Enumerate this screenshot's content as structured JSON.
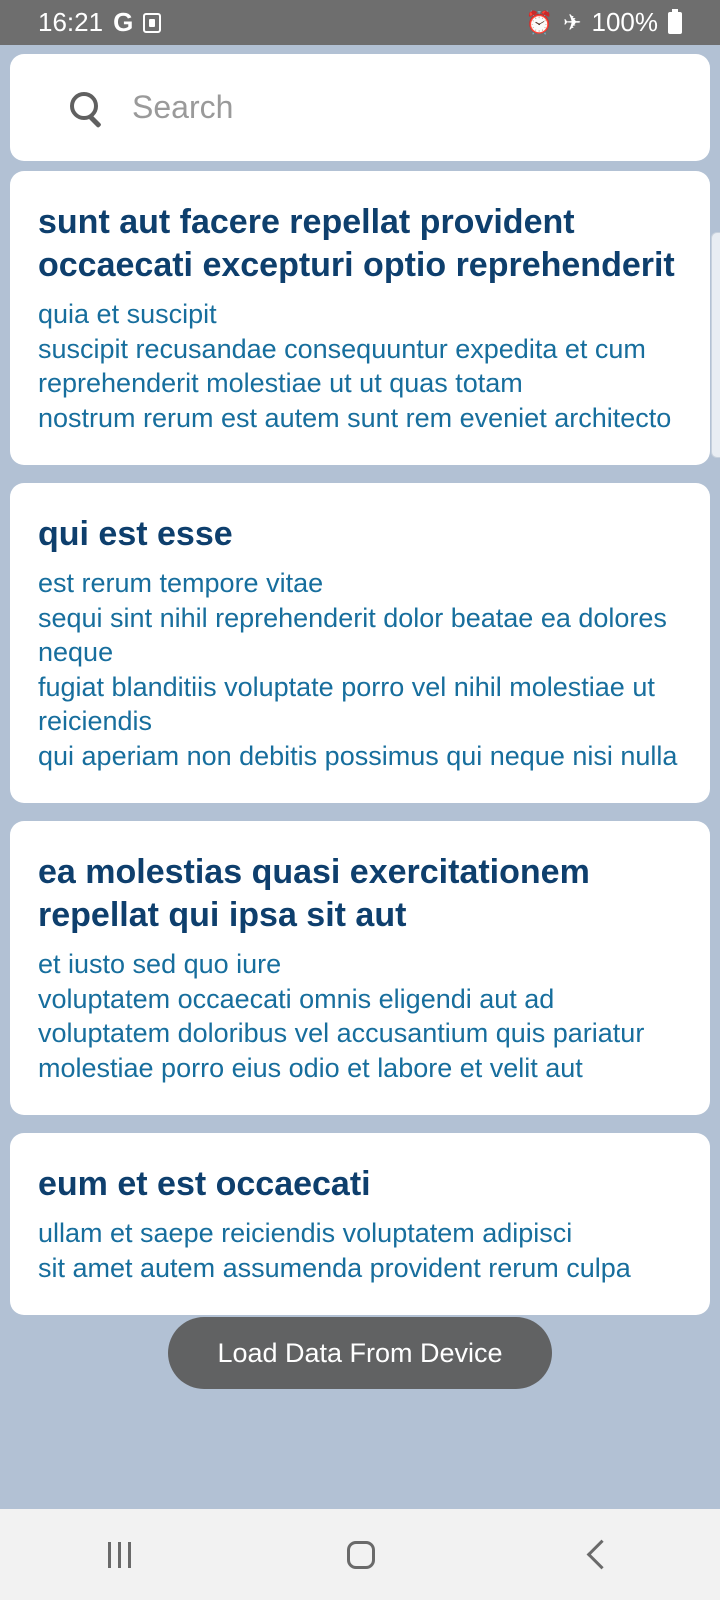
{
  "status_bar": {
    "time": "16:21",
    "g_icon": "G",
    "battery_text": "100%",
    "icons": [
      "google-icon",
      "notification-box-icon",
      "alarm-icon",
      "airplane-mode-icon",
      "battery-icon"
    ]
  },
  "search": {
    "placeholder": "Search",
    "value": ""
  },
  "posts": [
    {
      "title": "sunt aut facere repellat provident occaecati excepturi optio reprehenderit",
      "body": "quia et suscipit\nsuscipit recusandae consequuntur expedita et cum\nreprehenderit molestiae ut ut quas totam\nnostrum rerum est autem sunt rem eveniet architecto"
    },
    {
      "title": "qui est esse",
      "body": "est rerum tempore vitae\nsequi sint nihil reprehenderit dolor beatae ea dolores neque\nfugiat blanditiis voluptate porro vel nihil molestiae ut reiciendis\nqui aperiam non debitis possimus qui neque nisi nulla"
    },
    {
      "title": "ea molestias quasi exercitationem repellat qui ipsa sit aut",
      "body": "et iusto sed quo iure\nvoluptatem occaecati omnis eligendi aut ad\nvoluptatem doloribus vel accusantium quis pariatur\nmolestiae porro eius odio et labore et velit aut"
    },
    {
      "title": "eum et est occaecati",
      "body": "ullam et saepe reiciendis voluptatem adipisci\nsit amet autem assumenda provident rerum culpa"
    }
  ],
  "toast": {
    "text": "Load Data From Device"
  },
  "colors": {
    "background": "#b2c1d4",
    "title": "#0e3f6d",
    "body": "#176e9d",
    "status_bar": "#6e6e6e"
  }
}
